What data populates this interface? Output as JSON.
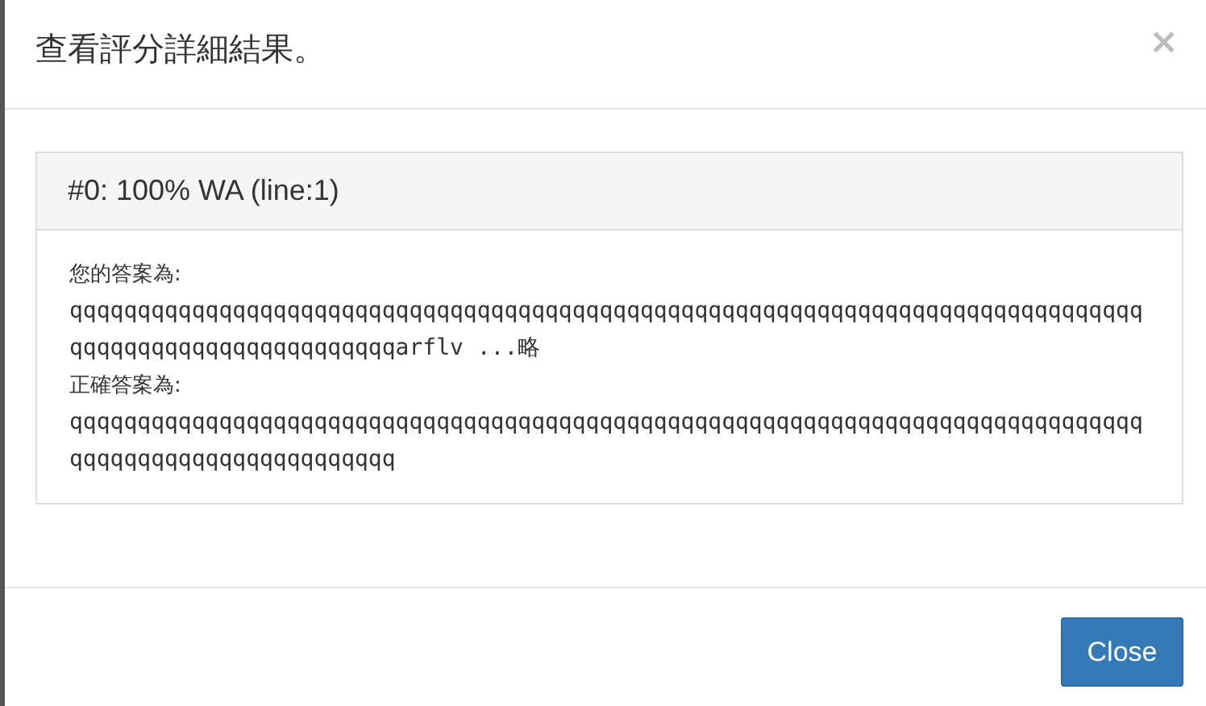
{
  "modal": {
    "title": "查看評分詳細結果。",
    "close_icon": "×"
  },
  "panel": {
    "heading": "#0: 100% WA (line:1)",
    "lines": [
      {
        "kind": "label",
        "text": "您的答案為:"
      },
      {
        "kind": "output",
        "text": "qqqqqqqqqqqqqqqqqqqqqqqqqqqqqqqqqqqqqqqqqqqqqqqqqqqqqqqqqqqqqqqqqqqqqqqqqqqqqqqqqqqqqqqqqqqqqqqqqqqqqqqarflv ...略"
      },
      {
        "kind": "label",
        "text": "正確答案為:"
      },
      {
        "kind": "output",
        "text": "qqqqqqqqqqqqqqqqqqqqqqqqqqqqqqqqqqqqqqqqqqqqqqqqqqqqqqqqqqqqqqqqqqqqqqqqqqqqqqqqqqqqqqqqqqqqqqqqqqqqqqq"
      }
    ]
  },
  "footer": {
    "button": "Close"
  }
}
